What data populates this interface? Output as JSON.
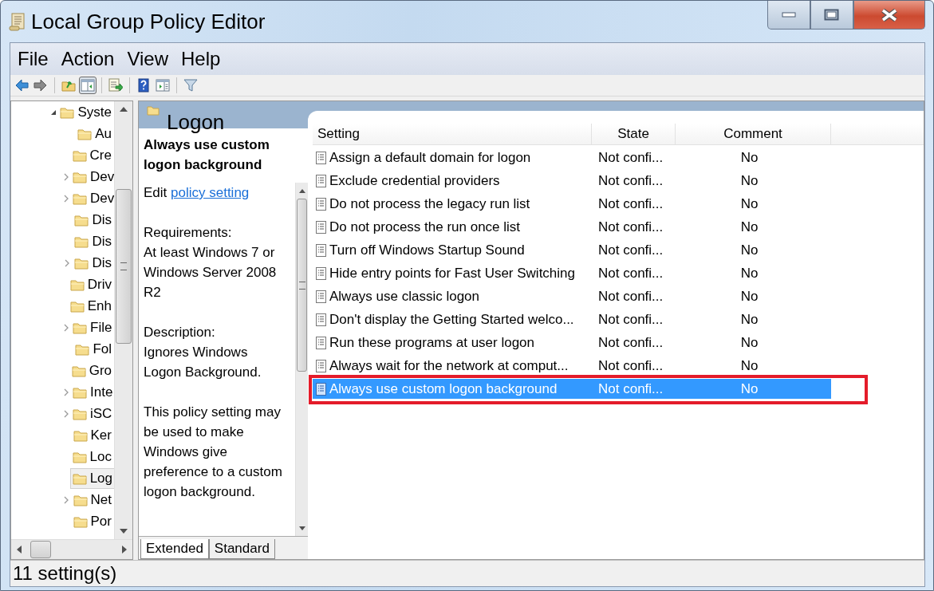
{
  "window": {
    "title": "Local Group Policy Editor"
  },
  "menu": [
    "File",
    "Action",
    "View",
    "Help"
  ],
  "toolbar": [
    [
      {
        "kind": "back",
        "pressed": false
      },
      {
        "kind": "forward",
        "pressed": false
      }
    ],
    [
      {
        "kind": "up",
        "pressed": false
      },
      {
        "kind": "console-tree",
        "pressed": true
      }
    ],
    [
      {
        "kind": "export",
        "pressed": false
      }
    ],
    [
      {
        "kind": "help",
        "pressed": false
      },
      {
        "kind": "action-pane",
        "pressed": false
      }
    ],
    [
      {
        "kind": "filter",
        "pressed": false
      }
    ]
  ],
  "tree": {
    "items": [
      {
        "label": "Syste",
        "has_children": true,
        "expanded": true,
        "selected": false,
        "children": [
          {
            "label": "Au",
            "has_children": false,
            "selected": false
          },
          {
            "label": "Cre",
            "has_children": false,
            "selected": false
          },
          {
            "label": "Dev",
            "has_children": true,
            "expanded": false,
            "selected": false
          },
          {
            "label": "Dev",
            "has_children": true,
            "expanded": false,
            "selected": false
          },
          {
            "label": "Dis",
            "has_children": false,
            "selected": false
          },
          {
            "label": "Dis",
            "has_children": false,
            "selected": false
          },
          {
            "label": "Dis",
            "has_children": true,
            "expanded": false,
            "selected": false
          },
          {
            "label": "Driv",
            "has_children": false,
            "selected": false
          },
          {
            "label": "Enh",
            "has_children": false,
            "selected": false
          },
          {
            "label": "File",
            "has_children": true,
            "expanded": false,
            "selected": false
          },
          {
            "label": "Fol",
            "has_children": false,
            "selected": false
          },
          {
            "label": "Gro",
            "has_children": false,
            "selected": false
          },
          {
            "label": "Inte",
            "has_children": true,
            "expanded": false,
            "selected": false
          },
          {
            "label": "iSC",
            "has_children": true,
            "expanded": false,
            "selected": false
          },
          {
            "label": "Ker",
            "has_children": false,
            "selected": false
          },
          {
            "label": "Loc",
            "has_children": false,
            "selected": false
          },
          {
            "label": "Log",
            "has_children": false,
            "selected": true
          },
          {
            "label": "Net",
            "has_children": true,
            "expanded": false,
            "selected": false
          },
          {
            "label": "Por",
            "has_children": false,
            "selected": false
          }
        ]
      }
    ]
  },
  "details": {
    "header": "Logon",
    "policy_title": "Always use custom logon background",
    "edit_prefix": "Edit",
    "edit_link": "policy setting",
    "paragraphs": [
      "Requirements:\nAt least Windows 7 or Windows Server 2008 R2",
      "Description:\nIgnores Windows Logon Background.",
      "This policy setting may be used to make Windows give preference to a custom logon background."
    ],
    "tabs": [
      {
        "label": "Extended",
        "selected": true
      },
      {
        "label": "Standard",
        "selected": false
      }
    ]
  },
  "table": {
    "columns": [
      "Setting",
      "State",
      "Comment"
    ],
    "rows": [
      {
        "setting": "Assign a default domain for logon",
        "state": "Not confi...",
        "comment": "No",
        "selected": false,
        "outlined": false
      },
      {
        "setting": "Exclude credential providers",
        "state": "Not confi...",
        "comment": "No",
        "selected": false,
        "outlined": false
      },
      {
        "setting": "Do not process the legacy run list",
        "state": "Not confi...",
        "comment": "No",
        "selected": false,
        "outlined": false
      },
      {
        "setting": "Do not process the run once list",
        "state": "Not confi...",
        "comment": "No",
        "selected": false,
        "outlined": false
      },
      {
        "setting": "Turn off Windows Startup Sound",
        "state": "Not confi...",
        "comment": "No",
        "selected": false,
        "outlined": false
      },
      {
        "setting": "Hide entry points for Fast User Switching",
        "state": "Not confi...",
        "comment": "No",
        "selected": false,
        "outlined": false
      },
      {
        "setting": "Always use classic logon",
        "state": "Not confi...",
        "comment": "No",
        "selected": false,
        "outlined": false
      },
      {
        "setting": "Don't display the Getting Started welco...",
        "state": "Not confi...",
        "comment": "No",
        "selected": false,
        "outlined": false
      },
      {
        "setting": "Run these programs at user logon",
        "state": "Not confi...",
        "comment": "No",
        "selected": false,
        "outlined": false
      },
      {
        "setting": "Always wait for the network at comput...",
        "state": "Not confi...",
        "comment": "No",
        "selected": false,
        "outlined": false
      },
      {
        "setting": "Always use custom logon background",
        "state": "Not confi...",
        "comment": "No",
        "selected": true,
        "outlined": true
      }
    ]
  },
  "status_bar": "11 setting(s)"
}
